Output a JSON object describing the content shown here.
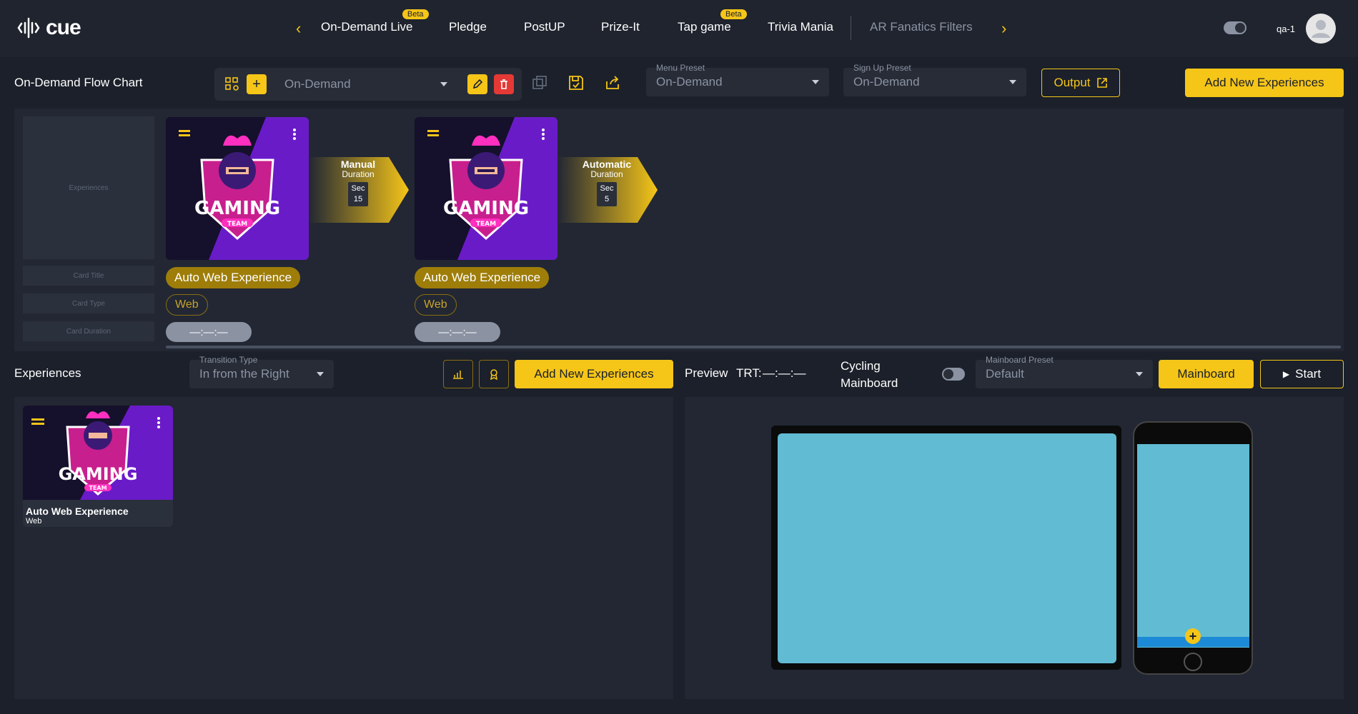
{
  "app": {
    "logo_text": "cue",
    "user": "qa-1"
  },
  "nav": {
    "items": [
      {
        "label": "On-Demand Live",
        "badge": "Beta"
      },
      {
        "label": "Pledge"
      },
      {
        "label": "PostUP"
      },
      {
        "label": "Prize-It"
      },
      {
        "label": "Tap game",
        "badge": "Beta"
      },
      {
        "label": "Trivia Mania"
      },
      {
        "label": "AR Fanatics Filters"
      }
    ]
  },
  "toolbar": {
    "title": "On-Demand Flow Chart",
    "flow_select": "On-Demand",
    "menu_preset_label": "Menu Preset",
    "menu_preset_value": "On-Demand",
    "signup_preset_label": "Sign Up Preset",
    "signup_preset_value": "On-Demand",
    "output_label": "Output",
    "add_new_label": "Add New Experiences"
  },
  "flow": {
    "placeholders": {
      "experiences": "Experiences",
      "card_title": "Card Title",
      "card_type": "Card Type",
      "card_duration": "Card Duration"
    },
    "cards": [
      {
        "title": "Auto Web Experience",
        "type": "Web",
        "duration": "—:—:—"
      },
      {
        "title": "Auto Web Experience",
        "type": "Web",
        "duration": "—:—:—"
      }
    ],
    "transitions": [
      {
        "mode": "Manual",
        "duration_label": "Duration",
        "unit": "Sec",
        "value": "15"
      },
      {
        "mode": "Automatic",
        "duration_label": "Duration",
        "unit": "Sec",
        "value": "5"
      }
    ]
  },
  "experiences": {
    "title": "Experiences",
    "transition_label": "Transition Type",
    "transition_value": "In from the Right",
    "add_new_label": "Add New Experiences",
    "items": [
      {
        "title": "Auto Web Experience",
        "type": "Web"
      }
    ]
  },
  "preview": {
    "title": "Preview",
    "trt_label": "TRT:",
    "trt_value": "—:—:—",
    "cycling_line1": "Cycling",
    "cycling_line2": "Mainboard",
    "mainboard_preset_label": "Mainboard Preset",
    "mainboard_preset_value": "Default",
    "mainboard_button": "Mainboard",
    "start_button": "Start"
  },
  "colors": {
    "accent": "#f5c518",
    "background": "#1b202a",
    "panel": "#222733",
    "danger": "#e53935",
    "preview_screen": "#61bbd3"
  }
}
